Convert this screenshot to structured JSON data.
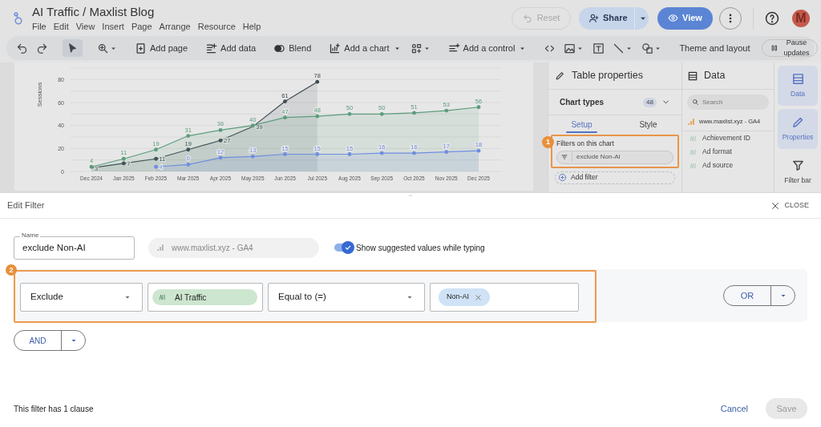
{
  "header": {
    "title": "AI Traffic / Maxlist Blog",
    "menu": [
      "File",
      "Edit",
      "View",
      "Insert",
      "Page",
      "Arrange",
      "Resource",
      "Help"
    ],
    "reset": {
      "label": "Reset",
      "disabled": true
    },
    "share": {
      "label": "Share"
    },
    "view": {
      "label": "View"
    },
    "avatar": "M"
  },
  "toolbar": {
    "items": [
      {
        "label": "Add page",
        "menu": false
      },
      {
        "label": "Add data",
        "menu": false
      },
      {
        "label": "Blend",
        "menu": false
      },
      {
        "label": "Add a chart",
        "menu": true
      },
      {
        "label": "Add a control",
        "menu": true
      },
      {
        "label": "Theme and layout",
        "menu": false
      }
    ],
    "pause": "Pause updates"
  },
  "canvas": {
    "chart_data": {
      "type": "line",
      "ylabel": "Sessions",
      "categories": [
        "Dec 2024",
        "Jan 2025",
        "Feb 2025",
        "Mar 2025",
        "Apr 2025",
        "May 2025",
        "Jun 2025",
        "Jul 2025",
        "Aug 2025",
        "Sep 2025",
        "Oct 2025",
        "Nov 2025",
        "Dec 2025"
      ],
      "ylim": [
        0,
        90
      ],
      "yticks": [
        0,
        20,
        40,
        60,
        80
      ],
      "grid": true,
      "data_labels": true,
      "series": [
        {
          "color": "#3d4a50",
          "values": [
            3,
            7,
            11,
            19,
            27,
            39,
            61,
            78,
            null,
            null,
            null,
            null,
            null
          ]
        },
        {
          "color": "#5c9c7c",
          "values": [
            4,
            11,
            19,
            31,
            36,
            40,
            47,
            48,
            50,
            50,
            51,
            53,
            56
          ]
        },
        {
          "color": "#6e8de0",
          "values": [
            null,
            null,
            4,
            6,
            12,
            13,
            15,
            15,
            15,
            16,
            16,
            17,
            18
          ]
        }
      ]
    }
  },
  "properties": {
    "title": "Table properties",
    "chart_types": {
      "label": "Chart types",
      "count": "48"
    },
    "tabs": [
      {
        "label": "Setup",
        "selected": true
      },
      {
        "label": "Style",
        "selected": false
      }
    ],
    "filters_label": "Filters on this chart",
    "filters": [
      "exclude Non-AI"
    ],
    "add_filter": "Add filter",
    "callout": "1"
  },
  "data_panel": {
    "title": "Data",
    "search": {
      "placeholder": "Search"
    },
    "source": "www.maxlist.xyz - GA4",
    "fields": [
      "Achievement ID",
      "Ad format",
      "Ad source"
    ]
  },
  "rail": [
    {
      "label": "Data",
      "selected": true
    },
    {
      "label": "Properties",
      "selected": true
    },
    {
      "label": "Filter bar",
      "selected": false
    }
  ],
  "edit_filter": {
    "title": "Edit Filter",
    "close": "CLOSE",
    "name": {
      "label": "Name",
      "value": "exclude Non-AI"
    },
    "source": "www.maxlist.xyz - GA4",
    "suggest": {
      "label": "Show suggested values while typing",
      "checked": true
    },
    "callout": "2",
    "clause": {
      "mode": "Exclude",
      "field": "AI Traffic",
      "operator": "Equal to (=)",
      "values": [
        "Non-AI"
      ]
    },
    "or": "OR",
    "and": "AND",
    "summary": "This filter has 1 clause",
    "cancel": "Cancel",
    "save": {
      "label": "Save",
      "disabled": true
    }
  }
}
